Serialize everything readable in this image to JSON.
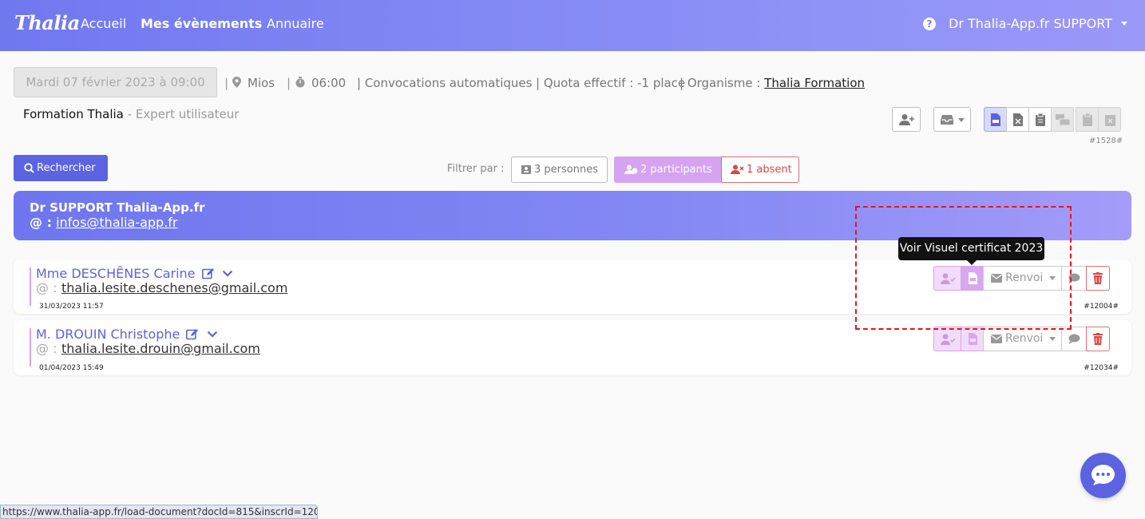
{
  "app": {
    "logo": "Thalia"
  },
  "nav": {
    "home": "Accueil",
    "events": "Mes évènements",
    "directory": "Annuaire"
  },
  "header": {
    "help_glyph": "?",
    "user": "Dr Thalia-App.fr SUPPORT"
  },
  "event": {
    "date": "Mardi 07 février 2023 à 09:00",
    "location": "Mios",
    "duration": "06:00",
    "convocations": "| Convocations automatiques",
    "quota": "| Quota effectif : -1 place",
    "organisme_label": "| Organisme : ",
    "organisme": "Thalia Formation",
    "separator": "|",
    "title": "Formation Thalia",
    "subtitle": " - Expert utilisateur",
    "ref": "#1528#"
  },
  "toolbar": {
    "search": "Rechercher",
    "filter_label": "Filtrer par :",
    "filter_persons": "3 personnes",
    "filter_participants": "2 participants",
    "filter_absent": "1 absent"
  },
  "organizer": {
    "name": "Dr SUPPORT Thalia-App.fr",
    "email_prefix": "@ :",
    "email": "infos@thalia-app.fr"
  },
  "participants": [
    {
      "name": "Mme DESCHÊNES Carine",
      "email_prefix": "@ :",
      "email": "thalia.lesite.deschenes@gmail.com",
      "date": "31/03/2023 11:57",
      "ref": "#12004#",
      "renvoi": "Renvoi"
    },
    {
      "name": "M. DROUIN Christophe",
      "email_prefix": "@ :",
      "email": "thalia.lesite.drouin@gmail.com",
      "date": "01/04/2023 15:49",
      "ref": "#12034#",
      "renvoi": "Renvoi"
    }
  ],
  "tooltip": "Voir Visuel certificat 2023",
  "status_url": "https://www.thalia-app.fr/load-document?docId=815&inscrId=12004",
  "colors": {
    "accent": "#5b63e0",
    "participant": "#d6a3f0",
    "danger": "#e07070"
  },
  "icons": [
    "question-icon",
    "caret-down-icon",
    "map-pin-icon",
    "stopwatch-icon",
    "user-plus-icon",
    "inbox-icon",
    "file-pdf-icon",
    "file-excel-icon",
    "clipboard-icon",
    "search-icon",
    "id-card-icon",
    "users-icon",
    "user-x-icon",
    "edit-icon",
    "chevron-down-icon",
    "user-check-icon",
    "envelope-icon",
    "comment-icon",
    "trash-icon",
    "chat-icon"
  ]
}
